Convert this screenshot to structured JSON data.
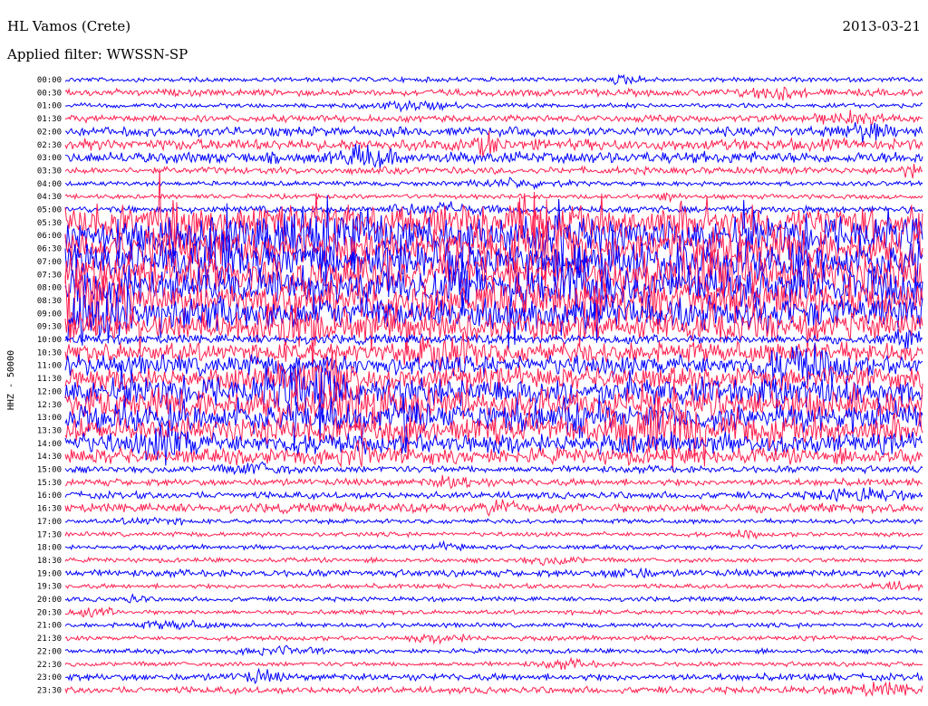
{
  "header": {
    "station": "HL Vamos (Crete)",
    "date": "2013-03-21",
    "filter": "Applied filter: WWSSN-SP"
  },
  "chart_data": {
    "type": "line",
    "title": "HL Vamos (Crete)",
    "ylabel": "HHZ - 50000",
    "xlabel": "",
    "rows": [
      "00:00",
      "00:30",
      "01:00",
      "01:30",
      "02:00",
      "02:30",
      "03:00",
      "03:30",
      "04:00",
      "04:30",
      "05:00",
      "05:30",
      "06:00",
      "06:30",
      "07:00",
      "07:30",
      "08:00",
      "08:30",
      "09:00",
      "09:30",
      "10:00",
      "10:30",
      "11:00",
      "11:30",
      "12:00",
      "12:30",
      "13:00",
      "13:30",
      "14:00",
      "14:30",
      "15:00",
      "15:30",
      "16:00",
      "16:30",
      "17:00",
      "17:30",
      "18:00",
      "18:30",
      "19:00",
      "19:30",
      "20:00",
      "20:30",
      "21:00",
      "21:30",
      "22:00",
      "22:30",
      "23:00",
      "23:30"
    ],
    "series_colors": [
      "#0000ff",
      "#ff2050"
    ],
    "row_amplitude": [
      2,
      3,
      2,
      3,
      4,
      5,
      5,
      3,
      2,
      2,
      3,
      14,
      16,
      16,
      16,
      16,
      16,
      16,
      14,
      12,
      4,
      9,
      9,
      10,
      12,
      13,
      12,
      11,
      9,
      7,
      3,
      3,
      3,
      4,
      2,
      2,
      2,
      2,
      3,
      2,
      2,
      2,
      2,
      2,
      2,
      2,
      3,
      3
    ],
    "grid": false,
    "legend": "none"
  }
}
